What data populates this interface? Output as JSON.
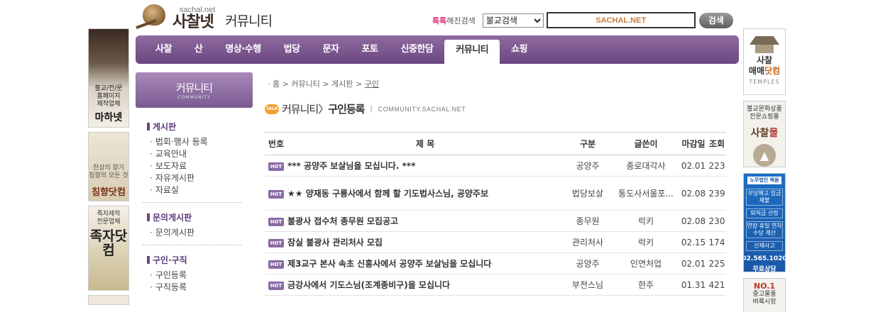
{
  "header": {
    "domain": "sachal.net",
    "logo_name": "사찰넷",
    "section": "커뮤니티",
    "hashtag_brand": "톡톡",
    "hashtag_label": "해진검색",
    "search_select": "불교검색",
    "search_value": "SACHAL.NET",
    "search_button": "검색"
  },
  "nav": {
    "items": [
      "사찰",
      "산",
      "명상·수행",
      "법당",
      "문자",
      "포토",
      "신중한담",
      "커뮤니티",
      "쇼핑"
    ],
    "active": "커뮤니티"
  },
  "left_ads": {
    "ad1_lines": [
      "불교/전/문",
      "홈페이지",
      "제작업체"
    ],
    "ad1_brand": "마하넷",
    "ad2_lines": [
      "천상의 향기",
      "침향의 모든 것"
    ],
    "ad2_brand": "침향닷컴",
    "ad3_lines": [
      "족자제작",
      "전문업체"
    ],
    "ad3_brand": "족자닷컴"
  },
  "right_ads": {
    "ad1_line1": "사찰",
    "ad1_line2a": "매매",
    "ad1_line2b": "닷컴",
    "ad1_en": "TEMPLES",
    "ad2_lines": [
      "불교문화상품",
      "전문쇼핑몰"
    ],
    "ad2_brand_a": "사찰",
    "ad2_brand_b": "몰",
    "ad3_logo": "노무법인 배움",
    "ad3_lines": [
      "부당해고 임금체불",
      "퇴직금 산정",
      "연장·휴일 연차수당 계산",
      "산재사고"
    ],
    "ad3_phone": "02.565.1020",
    "ad3_sub": "무료상담",
    "ad4_top": "NO.1",
    "ad4_lines": [
      "중고물품",
      "벼룩시장"
    ]
  },
  "sidebar": {
    "title": "커뮤니티",
    "title_en": "COMMUNITY",
    "groups": [
      {
        "head": "게시판",
        "items": [
          "법회·행사 등록",
          "교육안내",
          "보도자료",
          "자유게시판",
          "자료실"
        ]
      },
      {
        "head": "문의게시판",
        "items": [
          "문의게시판"
        ]
      },
      {
        "head": "구인·구직",
        "items": [
          "구인등록",
          "구직등록"
        ]
      }
    ]
  },
  "main": {
    "breadcrumb": [
      "홈",
      "커뮤니티",
      "게시판",
      "구인"
    ],
    "title_prefix": "커뮤니티",
    "title_current": "구인등록",
    "title_en": "COMMUNITY.SACHAL.NET",
    "talk_badge": "TALK",
    "columns": [
      "번호",
      "제 목",
      "구분",
      "글쓴이",
      "마감일",
      "조회"
    ],
    "rows": [
      {
        "badge": "HOT",
        "title": "*** 공양주 보살님을 모십니다. ***",
        "category": "공양주",
        "author": "종로대각사",
        "deadline": "02.01",
        "views": "223"
      },
      {
        "badge": "HOT",
        "title": "★★ 양재동 구룡사에서 함께 할 기도법사스님, 공양주보",
        "category": "법당보살",
        "author": "통도사서울포...",
        "deadline": "02.08",
        "views": "239"
      },
      {
        "badge": "HOT",
        "title": "불광사 접수처 종무원 모집공고",
        "category": "종무원",
        "author": "럭키",
        "deadline": "02.08",
        "views": "230"
      },
      {
        "badge": "HOT",
        "title": "잠실 불광사 관리처사 모집",
        "category": "관리처사",
        "author": "럭키",
        "deadline": "02.15",
        "views": "174"
      },
      {
        "badge": "HOT",
        "title": "제3교구 본사 속초 신흥사에서 공양주 보살님을 모십니다",
        "category": "공양주",
        "author": "인연처업",
        "deadline": "02.01",
        "views": "225"
      },
      {
        "badge": "HOT",
        "title": "금강사에서 기도스님(조계종비구)을 모십니다",
        "category": "부전스님",
        "author": "한주",
        "deadline": "01.31",
        "views": "421"
      }
    ]
  }
}
